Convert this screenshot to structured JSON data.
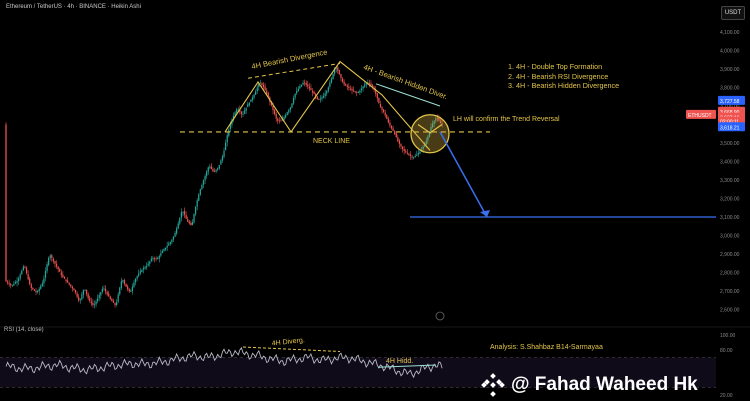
{
  "header": {
    "symbol_line": "Ethereum / TetherUS · 4h · BINANCE · Heikin Ashi",
    "currency": "USDT"
  },
  "notes": [
    "1. 4H - Double Top Formation",
    "2. 4H - Bearish RSI Divergence",
    "3. 4H - Bearish Hidden Divergence"
  ],
  "rsi": {
    "label": "RSI (14, close)",
    "axis": [
      "100.00",
      "80.00",
      "20.00"
    ]
  },
  "analysis": "Analysis: S.Shahbaz B14-Sarmayaa",
  "watermark": "@ Fahad Waheed Hk",
  "colors": {
    "bull": "#26a69a",
    "bear": "#ef5350",
    "annotation": "#e3c54a",
    "projection": "#3a6ff0",
    "rsi_line": "#b9b9c9"
  },
  "chart_data": {
    "type": "candlestick",
    "ylim": [
      2500,
      4100
    ],
    "price_ticks": [
      "4,100.00",
      "4,000.00",
      "3,900.00",
      "3,800.00",
      "3,700.00",
      "3,600.00",
      "3,500.00",
      "3,400.00",
      "3,300.00",
      "3,200.00",
      "3,100.00",
      "3,000.00",
      "2,900.00",
      "2,800.00",
      "2,700.00",
      "2,600.00"
    ],
    "price_path": [
      [
        0,
        2755
      ],
      [
        4,
        2728
      ],
      [
        8,
        2760
      ],
      [
        12,
        2840
      ],
      [
        16,
        2720
      ],
      [
        20,
        2690
      ],
      [
        24,
        2750
      ],
      [
        28,
        2900
      ],
      [
        32,
        2840
      ],
      [
        36,
        2780
      ],
      [
        40,
        2740
      ],
      [
        44,
        2700
      ],
      [
        47,
        2640
      ],
      [
        50,
        2720
      ],
      [
        53,
        2650
      ],
      [
        56,
        2620
      ],
      [
        59,
        2668
      ],
      [
        62,
        2720
      ],
      [
        64,
        2690
      ],
      [
        67,
        2650
      ],
      [
        70,
        2620
      ],
      [
        72,
        2700
      ],
      [
        74,
        2770
      ],
      [
        76,
        2730
      ],
      [
        79,
        2690
      ],
      [
        82,
        2760
      ],
      [
        85,
        2800
      ],
      [
        87,
        2820
      ],
      [
        90,
        2840
      ],
      [
        93,
        2880
      ],
      [
        96,
        2870
      ],
      [
        99,
        2910
      ],
      [
        102,
        2940
      ],
      [
        105,
        2970
      ],
      [
        107,
        3000
      ],
      [
        110,
        3080
      ],
      [
        112,
        3140
      ],
      [
        115,
        3080
      ],
      [
        118,
        3050
      ],
      [
        120,
        3140
      ],
      [
        123,
        3240
      ],
      [
        126,
        3310
      ],
      [
        129,
        3380
      ],
      [
        132,
        3340
      ],
      [
        135,
        3370
      ],
      [
        138,
        3440
      ],
      [
        141,
        3560
      ],
      [
        144,
        3640
      ],
      [
        147,
        3690
      ],
      [
        150,
        3650
      ],
      [
        153,
        3700
      ],
      [
        156,
        3740
      ],
      [
        158,
        3770
      ],
      [
        161,
        3830
      ],
      [
        163,
        3810
      ],
      [
        166,
        3760
      ],
      [
        169,
        3690
      ],
      [
        172,
        3620
      ],
      [
        175,
        3620
      ],
      [
        178,
        3660
      ],
      [
        181,
        3700
      ],
      [
        183,
        3760
      ],
      [
        186,
        3800
      ],
      [
        189,
        3830
      ],
      [
        192,
        3800
      ],
      [
        195,
        3770
      ],
      [
        198,
        3730
      ],
      [
        201,
        3750
      ],
      [
        204,
        3790
      ],
      [
        207,
        3860
      ],
      [
        209,
        3920
      ],
      [
        211,
        3880
      ],
      [
        214,
        3820
      ],
      [
        217,
        3800
      ],
      [
        220,
        3780
      ],
      [
        223,
        3770
      ],
      [
        226,
        3800
      ],
      [
        229,
        3830
      ],
      [
        231,
        3820
      ],
      [
        234,
        3780
      ],
      [
        237,
        3700
      ],
      [
        240,
        3660
      ],
      [
        243,
        3600
      ],
      [
        246,
        3560
      ],
      [
        249,
        3500
      ],
      [
        252,
        3460
      ],
      [
        255,
        3440
      ],
      [
        258,
        3420
      ],
      [
        261,
        3440
      ],
      [
        264,
        3470
      ],
      [
        267,
        3520
      ],
      [
        270,
        3600
      ],
      [
        273,
        3640
      ],
      [
        276,
        3600
      ]
    ],
    "annotations": [
      {
        "text": "4H Bearish Divergence"
      },
      {
        "text": "4H - Bearish Hidden Diver."
      },
      {
        "text": "LH will confirm the Trend Reversal"
      },
      {
        "text": "NECK LINE"
      },
      {
        "text": "4H Diverg."
      },
      {
        "text": "4H Hidd."
      }
    ],
    "price_labels": [
      {
        "value": "3,727.58",
        "color": "#2962ff",
        "y": 3727.58
      },
      {
        "value": "3,668.90",
        "color": "#ef5350",
        "y": 3668.9
      },
      {
        "value": "3,637.16",
        "color": "#ef5350",
        "y": 3637.16
      },
      {
        "value": "02:00:11",
        "color": "#ef5350",
        "y": 3615
      },
      {
        "value": "3,618.21",
        "color": "#2962ff",
        "y": 3585
      },
      {
        "value": "ETHUSDT",
        "color": "#ef5350",
        "y": 3652
      }
    ],
    "neckline": 3560,
    "target": 3100,
    "rsi_path": [
      [
        0,
        58
      ],
      [
        8,
        56
      ],
      [
        16,
        55
      ],
      [
        24,
        58
      ],
      [
        32,
        60
      ],
      [
        40,
        57
      ],
      [
        48,
        54
      ],
      [
        56,
        55
      ],
      [
        64,
        58
      ],
      [
        72,
        60
      ],
      [
        80,
        62
      ],
      [
        88,
        61
      ],
      [
        96,
        63
      ],
      [
        104,
        66
      ],
      [
        112,
        70
      ],
      [
        120,
        72
      ],
      [
        128,
        70
      ],
      [
        136,
        74
      ],
      [
        144,
        78
      ],
      [
        152,
        75
      ],
      [
        160,
        72
      ],
      [
        168,
        68
      ],
      [
        176,
        65
      ],
      [
        184,
        68
      ],
      [
        192,
        70
      ],
      [
        200,
        66
      ],
      [
        208,
        69
      ],
      [
        216,
        70
      ],
      [
        224,
        66
      ],
      [
        232,
        62
      ],
      [
        240,
        58
      ],
      [
        248,
        52
      ],
      [
        256,
        48
      ],
      [
        264,
        55
      ],
      [
        272,
        60
      ],
      [
        276,
        57
      ]
    ],
    "rsi_ylim": [
      20,
      100
    ]
  }
}
